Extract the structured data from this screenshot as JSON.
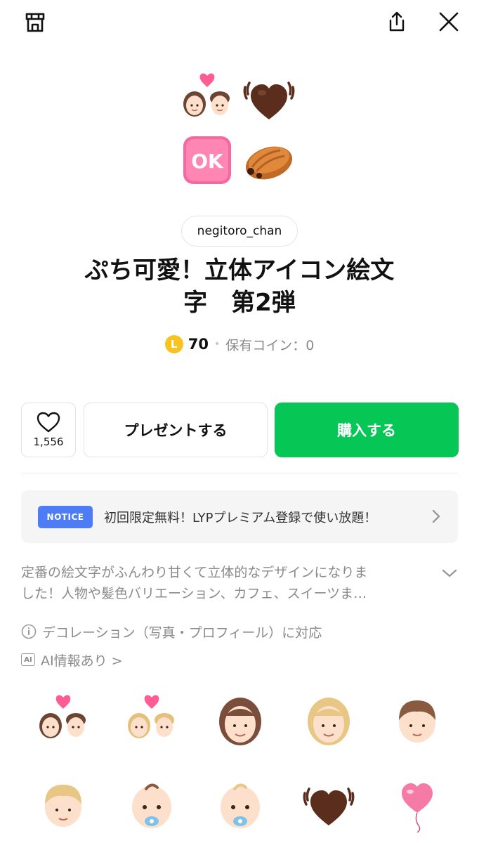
{
  "header": {
    "shop_icon": "shop-icon",
    "share_icon": "share-icon",
    "close_icon": "close-icon"
  },
  "hero_emojis": [
    "couple-with-heart",
    "beating-heart-brown",
    "ok-button",
    "pain-au-chocolat"
  ],
  "author": "negitoro_chan",
  "title_lines": [
    "ぷち可愛！立体アイコン絵文",
    "字　第2弾"
  ],
  "price": {
    "coin_symbol": "L",
    "value": "70",
    "owned_label": "保有コイン：0"
  },
  "actions": {
    "like_count": "1,556",
    "present_label": "プレゼントする",
    "buy_label": "購入する"
  },
  "notice": {
    "badge": "NOTICE",
    "text": "初回限定無料！LYPプレミアム登録で使い放題！"
  },
  "description": {
    "line1": "定番の絵文字がふんわり甘くて立体的なデザインになりま",
    "line2": "した！人物や髪色バリエーション、カフェ、スイーツま…"
  },
  "meta": {
    "decoration": "デコレーション（写真・プロフィール）に対応",
    "ai_badge": "AI",
    "ai_info": "AI情報あり >"
  },
  "grid_emojis": [
    "couple-with-heart",
    "couple-with-heart-blonde",
    "woman-brown-hair",
    "woman-blonde-hair",
    "boy-brown-hair",
    "boy-blonde-hair",
    "baby-brown",
    "baby-blonde",
    "beating-heart-brown",
    "heart-balloon"
  ],
  "colors": {
    "accent": "#06c755",
    "notice_badge": "#4d7cf4",
    "coin": "#f6c323"
  }
}
